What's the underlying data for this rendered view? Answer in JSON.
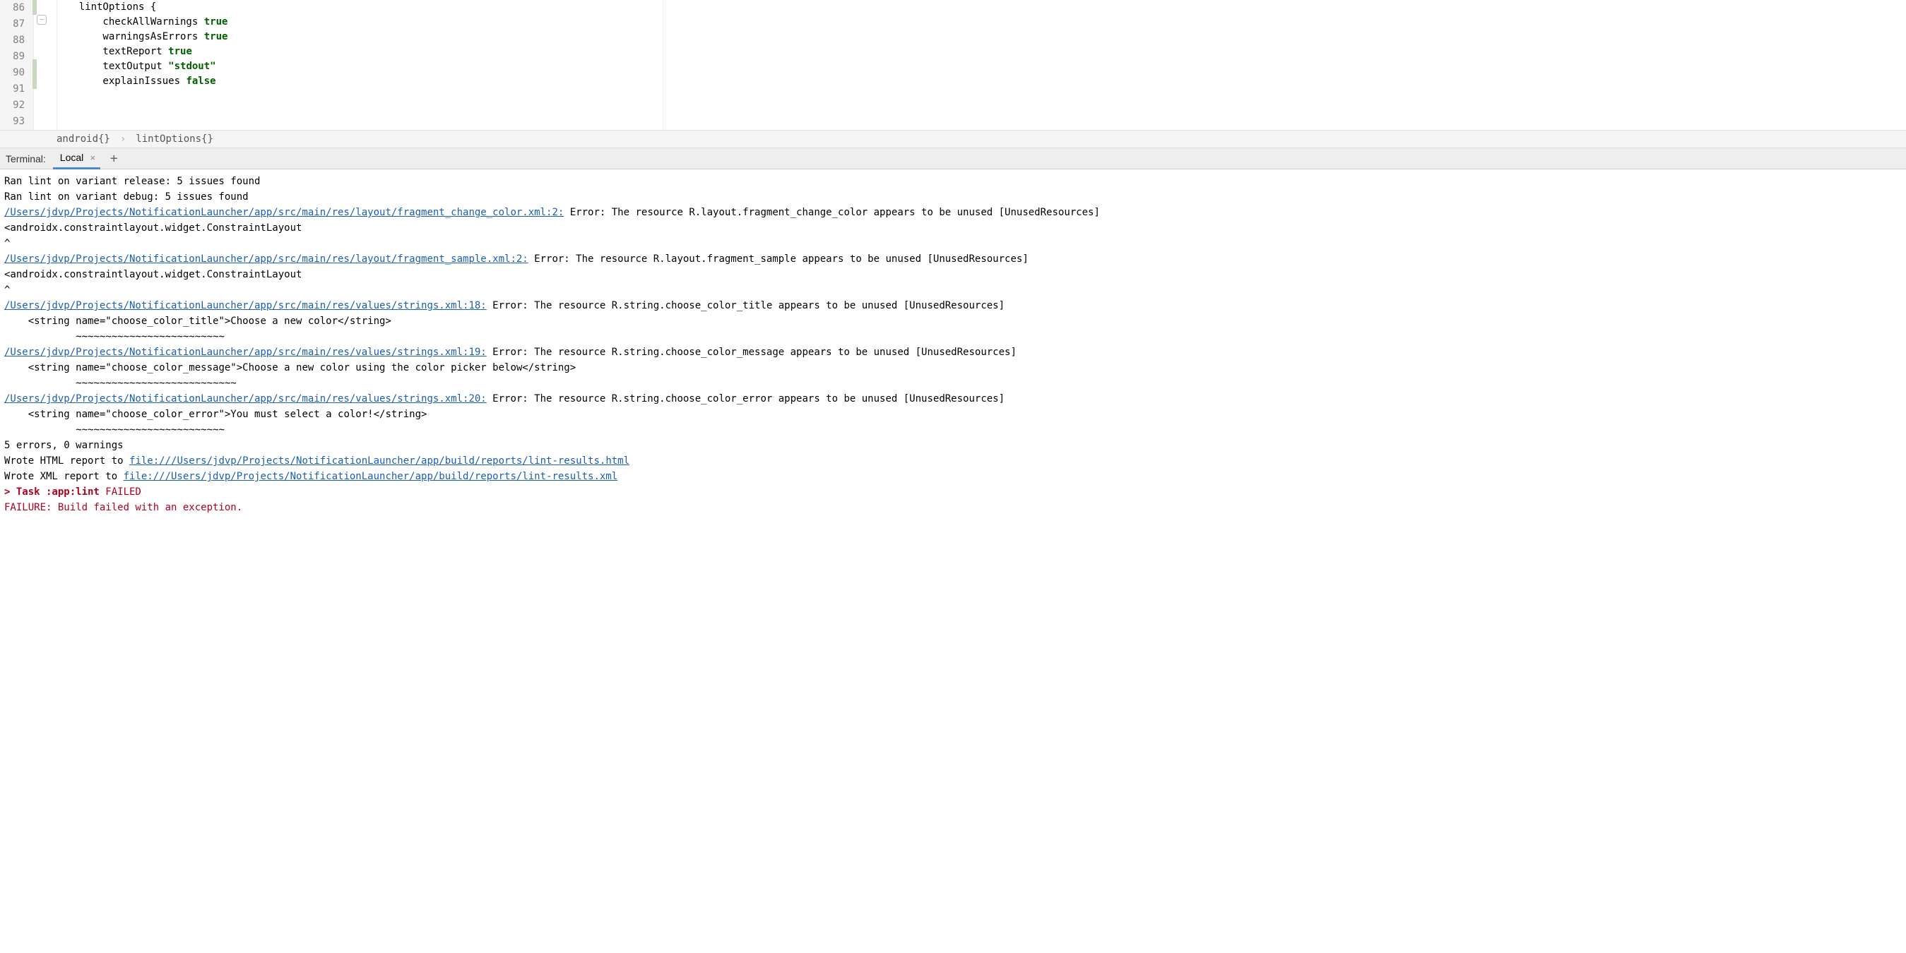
{
  "editor": {
    "lines": [
      {
        "n": 86,
        "indent": "",
        "plain": ""
      },
      {
        "n": 87,
        "indent": "    ",
        "plain": "lintOptions {"
      },
      {
        "n": 88,
        "indent": "        ",
        "label": "checkAllWarnings ",
        "kw": "true",
        "kwClass": "kw-true"
      },
      {
        "n": 89,
        "indent": "        ",
        "label": "warningsAsErrors ",
        "kw": "true",
        "kwClass": "kw-true"
      },
      {
        "n": 90,
        "indent": "        ",
        "label": "textReport ",
        "kw": "true",
        "kwClass": "kw-true"
      },
      {
        "n": 91,
        "indent": "        ",
        "label": "textOutput ",
        "kw": "\"stdout\"",
        "kwClass": "kw-string"
      },
      {
        "n": 92,
        "indent": "        ",
        "label": "explainIssues ",
        "kw": "false",
        "kwClass": "kw-false"
      },
      {
        "n": 93,
        "indent": "",
        "plain": ""
      }
    ]
  },
  "breadcrumb": {
    "items": [
      "android{}",
      "lintOptions{}"
    ]
  },
  "termTabs": {
    "title": "Terminal:",
    "activeTab": "Local",
    "addTooltip": "+"
  },
  "terminal": {
    "lines": [
      {
        "segs": [
          {
            "t": "Ran lint on variant release: 5 issues found"
          }
        ]
      },
      {
        "segs": [
          {
            "t": "Ran lint on variant debug: 5 issues found"
          }
        ]
      },
      {
        "segs": [
          {
            "t": "/Users/jdvp/Projects/NotificationLauncher/app/src/main/res/layout/fragment_change_color.xml:2:",
            "cls": "t-link"
          },
          {
            "t": " Error: The resource R.layout.fragment_change_color appears to be unused [UnusedResources]"
          }
        ]
      },
      {
        "segs": [
          {
            "t": "<androidx.constraintlayout.widget.ConstraintLayout"
          }
        ]
      },
      {
        "segs": [
          {
            "t": "^"
          }
        ]
      },
      {
        "segs": [
          {
            "t": "/Users/jdvp/Projects/NotificationLauncher/app/src/main/res/layout/fragment_sample.xml:2:",
            "cls": "t-link"
          },
          {
            "t": " Error: The resource R.layout.fragment_sample appears to be unused [UnusedResources]"
          }
        ]
      },
      {
        "segs": [
          {
            "t": "<androidx.constraintlayout.widget.ConstraintLayout"
          }
        ]
      },
      {
        "segs": [
          {
            "t": "^"
          }
        ]
      },
      {
        "segs": [
          {
            "t": "/Users/jdvp/Projects/NotificationLauncher/app/src/main/res/values/strings.xml:18:",
            "cls": "t-link"
          },
          {
            "t": " Error: The resource R.string.choose_color_title appears to be unused [UnusedResources]"
          }
        ]
      },
      {
        "segs": [
          {
            "t": "    <string name=\"choose_color_title\">Choose a new color</string>"
          }
        ]
      },
      {
        "segs": [
          {
            "t": "            ~~~~~~~~~~~~~~~~~~~~~~~~~"
          }
        ]
      },
      {
        "segs": [
          {
            "t": "/Users/jdvp/Projects/NotificationLauncher/app/src/main/res/values/strings.xml:19:",
            "cls": "t-link"
          },
          {
            "t": " Error: The resource R.string.choose_color_message appears to be unused [UnusedResources]"
          }
        ]
      },
      {
        "segs": [
          {
            "t": "    <string name=\"choose_color_message\">Choose a new color using the color picker below</string>"
          }
        ]
      },
      {
        "segs": [
          {
            "t": "            ~~~~~~~~~~~~~~~~~~~~~~~~~~~"
          }
        ]
      },
      {
        "segs": [
          {
            "t": "/Users/jdvp/Projects/NotificationLauncher/app/src/main/res/values/strings.xml:20:",
            "cls": "t-link"
          },
          {
            "t": " Error: The resource R.string.choose_color_error appears to be unused [UnusedResources]"
          }
        ]
      },
      {
        "segs": [
          {
            "t": "    <string name=\"choose_color_error\">You must select a color!</string>"
          }
        ]
      },
      {
        "segs": [
          {
            "t": "            ~~~~~~~~~~~~~~~~~~~~~~~~~"
          }
        ]
      },
      {
        "segs": [
          {
            "t": "5 errors, 0 warnings"
          }
        ]
      },
      {
        "segs": [
          {
            "t": "Wrote HTML report to "
          },
          {
            "t": "file:///Users/jdvp/Projects/NotificationLauncher/app/build/reports/lint-results.html",
            "cls": "t-link"
          }
        ]
      },
      {
        "segs": [
          {
            "t": "Wrote XML report to "
          },
          {
            "t": "file:///Users/jdvp/Projects/NotificationLauncher/app/build/reports/lint-results.xml",
            "cls": "t-link"
          }
        ]
      },
      {
        "segs": [
          {
            "t": ""
          }
        ]
      },
      {
        "segs": [
          {
            "t": "> Task :app:lint",
            "cls": "t-red t-bold"
          },
          {
            "t": " FAILED",
            "cls": "t-red"
          }
        ]
      },
      {
        "segs": [
          {
            "t": ""
          }
        ]
      },
      {
        "segs": [
          {
            "t": "FAILURE: Build failed with an exception.",
            "cls": "t-red"
          }
        ]
      }
    ]
  }
}
